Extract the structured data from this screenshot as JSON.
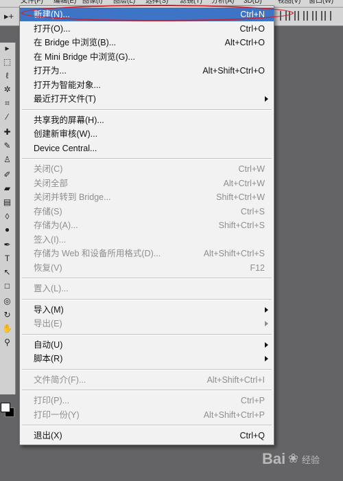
{
  "menubar": {
    "items": [
      {
        "label": "文件(F)"
      },
      {
        "label": "编辑(E)"
      },
      {
        "label": "图像(I)"
      },
      {
        "label": "图层(L)"
      },
      {
        "label": "选择(S)"
      },
      {
        "label": "滤镜(T)"
      },
      {
        "label": "分析(A)"
      },
      {
        "label": "3D(D)"
      },
      {
        "label": "视图(V)"
      },
      {
        "label": "窗口(W)"
      }
    ]
  },
  "file_menu": {
    "highlight_color": "#3d74c6",
    "annotation_color": "#d0202a",
    "groups": [
      {
        "items": [
          {
            "label": "新建(N)...",
            "shortcut": "Ctrl+N",
            "enabled": true,
            "highlighted": true
          },
          {
            "label": "打开(O)...",
            "shortcut": "Ctrl+O",
            "enabled": true
          },
          {
            "label": "在 Bridge 中浏览(B)...",
            "shortcut": "Alt+Ctrl+O",
            "enabled": true
          },
          {
            "label": "在 Mini Bridge 中浏览(G)...",
            "shortcut": "",
            "enabled": true
          },
          {
            "label": "打开为...",
            "shortcut": "Alt+Shift+Ctrl+O",
            "enabled": true
          },
          {
            "label": "打开为智能对象...",
            "shortcut": "",
            "enabled": true
          },
          {
            "label": "最近打开文件(T)",
            "shortcut": "",
            "enabled": true,
            "submenu": true
          }
        ]
      },
      {
        "items": [
          {
            "label": "共享我的屏幕(H)...",
            "shortcut": "",
            "enabled": true
          },
          {
            "label": "创建新审核(W)...",
            "shortcut": "",
            "enabled": true
          },
          {
            "label": "Device Central...",
            "shortcut": "",
            "enabled": true
          }
        ]
      },
      {
        "items": [
          {
            "label": "关闭(C)",
            "shortcut": "Ctrl+W",
            "enabled": false
          },
          {
            "label": "关闭全部",
            "shortcut": "Alt+Ctrl+W",
            "enabled": false
          },
          {
            "label": "关闭并转到 Bridge...",
            "shortcut": "Shift+Ctrl+W",
            "enabled": false
          },
          {
            "label": "存储(S)",
            "shortcut": "Ctrl+S",
            "enabled": false
          },
          {
            "label": "存储为(A)...",
            "shortcut": "Shift+Ctrl+S",
            "enabled": false
          },
          {
            "label": "签入(I)...",
            "shortcut": "",
            "enabled": false
          },
          {
            "label": "存储为 Web 和设备所用格式(D)...",
            "shortcut": "Alt+Shift+Ctrl+S",
            "enabled": false
          },
          {
            "label": "恢复(V)",
            "shortcut": "F12",
            "enabled": false
          }
        ]
      },
      {
        "items": [
          {
            "label": "置入(L)...",
            "shortcut": "",
            "enabled": false
          }
        ]
      },
      {
        "items": [
          {
            "label": "导入(M)",
            "shortcut": "",
            "enabled": true,
            "submenu": true
          },
          {
            "label": "导出(E)",
            "shortcut": "",
            "enabled": false,
            "submenu": true
          }
        ]
      },
      {
        "items": [
          {
            "label": "自动(U)",
            "shortcut": "",
            "enabled": true,
            "submenu": true
          },
          {
            "label": "脚本(R)",
            "shortcut": "",
            "enabled": true,
            "submenu": true
          }
        ]
      },
      {
        "items": [
          {
            "label": "文件简介(F)...",
            "shortcut": "Alt+Shift+Ctrl+I",
            "enabled": false
          }
        ]
      },
      {
        "items": [
          {
            "label": "打印(P)...",
            "shortcut": "Ctrl+P",
            "enabled": false
          },
          {
            "label": "打印一份(Y)",
            "shortcut": "Alt+Shift+Ctrl+P",
            "enabled": false
          }
        ]
      },
      {
        "items": [
          {
            "label": "退出(X)",
            "shortcut": "Ctrl+Q",
            "enabled": true
          }
        ]
      }
    ]
  },
  "toolbox": {
    "tools": [
      {
        "icon": "move-tool-icon",
        "glyph": "▸"
      },
      {
        "icon": "marquee-tool-icon",
        "glyph": "⬚"
      },
      {
        "icon": "lasso-tool-icon",
        "glyph": "ℓ"
      },
      {
        "icon": "quick-select-tool-icon",
        "glyph": "✲"
      },
      {
        "icon": "crop-tool-icon",
        "glyph": "⌗"
      },
      {
        "icon": "eyedropper-tool-icon",
        "glyph": "⁄"
      },
      {
        "icon": "healing-brush-tool-icon",
        "glyph": "✚"
      },
      {
        "icon": "brush-tool-icon",
        "glyph": "✎"
      },
      {
        "icon": "clone-stamp-tool-icon",
        "glyph": "♙"
      },
      {
        "icon": "history-brush-tool-icon",
        "glyph": "✐"
      },
      {
        "icon": "eraser-tool-icon",
        "glyph": "▰"
      },
      {
        "icon": "gradient-tool-icon",
        "glyph": "▤"
      },
      {
        "icon": "blur-tool-icon",
        "glyph": "◊"
      },
      {
        "icon": "dodge-tool-icon",
        "glyph": "●"
      },
      {
        "icon": "pen-tool-icon",
        "glyph": "✒"
      },
      {
        "icon": "type-tool-icon",
        "glyph": "T"
      },
      {
        "icon": "path-select-tool-icon",
        "glyph": "↖"
      },
      {
        "icon": "rectangle-tool-icon",
        "glyph": "□"
      },
      {
        "icon": "3d-rotate-tool-icon",
        "glyph": "◎"
      },
      {
        "icon": "3d-orbit-tool-icon",
        "glyph": "↻"
      },
      {
        "icon": "hand-tool-icon",
        "glyph": "✋"
      },
      {
        "icon": "zoom-tool-icon",
        "glyph": "⚲"
      }
    ],
    "foreground_color": "#ffffff",
    "background_color": "#000000"
  },
  "watermark": {
    "brand": "Bai",
    "brand_suffix": "经验"
  }
}
